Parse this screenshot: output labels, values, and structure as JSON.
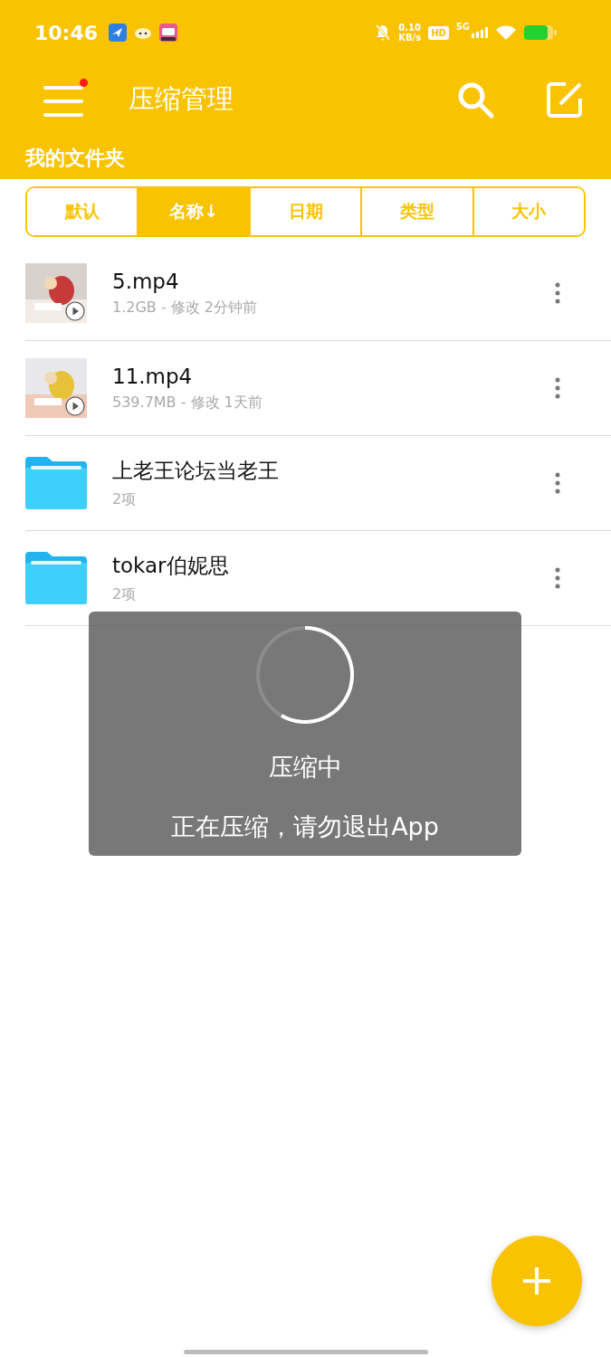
{
  "status_bar": {
    "time": "10:46",
    "net_speed": "0.10",
    "net_unit": "KB/s",
    "hd": "HD",
    "network": "5G"
  },
  "app_bar": {
    "title": "压缩管理",
    "menu_badge": true
  },
  "section_title": "我的文件夹",
  "sort_tabs": [
    {
      "label": "默认",
      "selected": false
    },
    {
      "label": "名称↓",
      "selected": true
    },
    {
      "label": "日期",
      "selected": false
    },
    {
      "label": "类型",
      "selected": false
    },
    {
      "label": "大小",
      "selected": false
    }
  ],
  "files": [
    {
      "kind": "video",
      "name": "5.mp4",
      "meta": "1.2GB - 修改 2分钟前"
    },
    {
      "kind": "video",
      "name": "11.mp4",
      "meta": "539.7MB - 修改 1天前"
    },
    {
      "kind": "folder",
      "name": "上老王论坛当老王",
      "meta": "2项"
    },
    {
      "kind": "folder",
      "name": "tokar伯妮思",
      "meta": "2项"
    }
  ],
  "dialog": {
    "title": "压缩中",
    "message": "正在压缩，请勿退出App"
  }
}
